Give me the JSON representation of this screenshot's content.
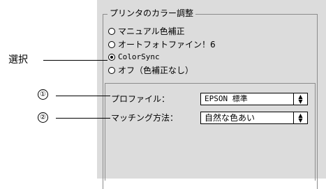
{
  "group": {
    "title": "プリンタのカラー調整",
    "options": [
      {
        "label": "マニュアル色補正",
        "selected": false
      },
      {
        "label": "オートフォトファイン！6",
        "selected": false
      },
      {
        "label": "ColorSync",
        "selected": true
      },
      {
        "label": "オフ（色補正なし）",
        "selected": false
      }
    ]
  },
  "settings": {
    "profile_label": "プロファイル：",
    "profile_value": "EPSON 標準",
    "matching_label": "マッチング方法：",
    "matching_value": "自然な色あい"
  },
  "callouts": {
    "select_label": "選択",
    "num1": "①",
    "num2": "②"
  }
}
